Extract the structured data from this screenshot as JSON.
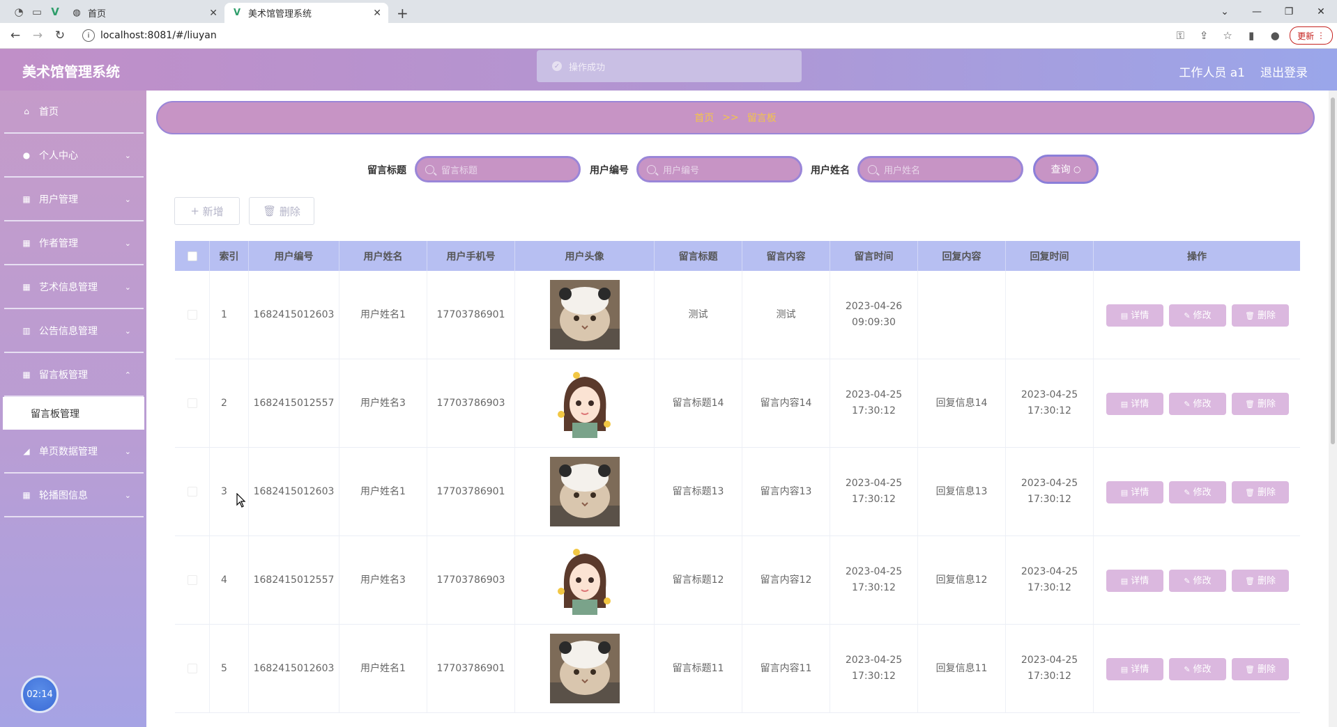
{
  "browser": {
    "tabs": [
      {
        "title": "首页",
        "active": false
      },
      {
        "title": "美术馆管理系统",
        "active": true
      }
    ],
    "url": "localhost:8081/#/liuyan",
    "update_label": "更新"
  },
  "header": {
    "title": "美术馆管理系统",
    "toast": "操作成功",
    "user": "工作人员 a1",
    "logout": "退出登录"
  },
  "sidebar": {
    "items": [
      {
        "label": "首页",
        "icon": "home-icon"
      },
      {
        "label": "个人中心",
        "icon": "user-icon"
      },
      {
        "label": "用户管理",
        "icon": "grid-icon"
      },
      {
        "label": "作者管理",
        "icon": "grid-icon"
      },
      {
        "label": "艺术信息管理",
        "icon": "grid-icon"
      },
      {
        "label": "公告信息管理",
        "icon": "bar-chart-icon"
      },
      {
        "label": "留言板管理",
        "icon": "grid-icon"
      },
      {
        "label": "单页数据管理",
        "icon": "chart-icon"
      },
      {
        "label": "轮播图信息",
        "icon": "grid-icon"
      }
    ],
    "sub_item": "留言板管理",
    "clock": "02:14"
  },
  "breadcrumb": {
    "home": "首页",
    "sep": ">>",
    "current": "留言板"
  },
  "search": {
    "title_label": "留言标题",
    "title_placeholder": "留言标题",
    "userno_label": "用户编号",
    "userno_placeholder": "用户编号",
    "username_label": "用户姓名",
    "username_placeholder": "用户姓名",
    "query": "查询"
  },
  "actions": {
    "add": "新增",
    "delete": "删除"
  },
  "table": {
    "headers": [
      "索引",
      "用户编号",
      "用户姓名",
      "用户手机号",
      "用户头像",
      "留言标题",
      "留言内容",
      "留言时间",
      "回复内容",
      "回复时间",
      "操作"
    ],
    "ops": {
      "detail": "详情",
      "edit": "修改",
      "delete": "删除"
    },
    "rows": [
      {
        "index": "1",
        "user_no": "1682415012603",
        "user_name": "用户姓名1",
        "phone": "17703786901",
        "avatar": "cat",
        "title": "测试",
        "content": "测试",
        "time": "2023-04-26 09:09:30",
        "reply": "",
        "reply_time": ""
      },
      {
        "index": "2",
        "user_no": "1682415012557",
        "user_name": "用户姓名3",
        "phone": "17703786903",
        "avatar": "girl",
        "title": "留言标题14",
        "content": "留言内容14",
        "time": "2023-04-25 17:30:12",
        "reply": "回复信息14",
        "reply_time": "2023-04-25 17:30:12"
      },
      {
        "index": "3",
        "user_no": "1682415012603",
        "user_name": "用户姓名1",
        "phone": "17703786901",
        "avatar": "cat",
        "title": "留言标题13",
        "content": "留言内容13",
        "time": "2023-04-25 17:30:12",
        "reply": "回复信息13",
        "reply_time": "2023-04-25 17:30:12"
      },
      {
        "index": "4",
        "user_no": "1682415012557",
        "user_name": "用户姓名3",
        "phone": "17703786903",
        "avatar": "girl",
        "title": "留言标题12",
        "content": "留言内容12",
        "time": "2023-04-25 17:30:12",
        "reply": "回复信息12",
        "reply_time": "2023-04-25 17:30:12"
      },
      {
        "index": "5",
        "user_no": "1682415012603",
        "user_name": "用户姓名1",
        "phone": "17703786901",
        "avatar": "cat",
        "title": "留言标题11",
        "content": "留言内容11",
        "time": "2023-04-25 17:30:12",
        "reply": "回复信息11",
        "reply_time": "2023-04-25 17:30:12"
      }
    ]
  },
  "colors": {
    "header_start": "#c08fc8",
    "header_end": "#9aa6ea",
    "breadcrumb_bg": "#c794c5",
    "breadcrumb_text": "#f3c44a",
    "table_header": "#b7bff2",
    "op_button": "#dbb8df"
  }
}
